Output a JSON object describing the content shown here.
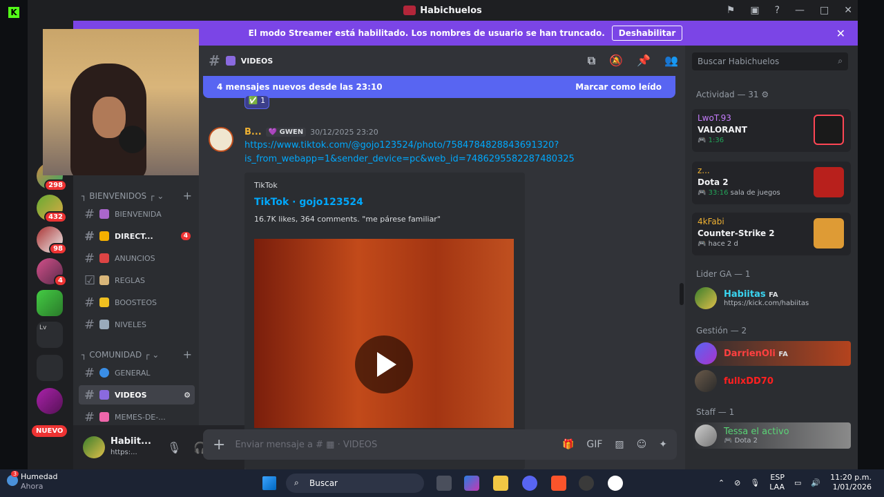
{
  "window": {
    "title": "Habichuelos"
  },
  "banner": {
    "text": "El modo Streamer está habilitado. Los nombres de usuario se han truncado.",
    "button": "Deshabilitar"
  },
  "channel_header": {
    "name": "VIDEOS"
  },
  "new_messages": {
    "text": "4 mensajes nuevos desde las 23:10",
    "mark_read": "Marcar como leído"
  },
  "servers": [
    {
      "badge": "298"
    },
    {
      "badge": "432"
    },
    {
      "badge": "98"
    },
    {
      "badge": "4"
    },
    {
      "badge": ""
    },
    {
      "badge": "Lv"
    }
  ],
  "server_nuevo": "NUEVO",
  "categories": {
    "bienvenidos": "BIENVENIDOS",
    "comunidad": "COMUNIDAD"
  },
  "channels": [
    {
      "name": "BIENVENIDA"
    },
    {
      "name": "DIRECT...",
      "badge": "4"
    },
    {
      "name": "ANUNCIOS"
    },
    {
      "name": "REGLAS"
    },
    {
      "name": "BOOSTEOS"
    },
    {
      "name": "NIVELES"
    },
    {
      "name": "GENERAL"
    },
    {
      "name": "VIDEOS"
    },
    {
      "name": "MEMES-DE-..."
    }
  ],
  "user": {
    "name": "Habiit...",
    "status": "https:..."
  },
  "message": {
    "reaction_count": "1",
    "author": "B...",
    "tag": "GWEN",
    "timestamp": "30/12/2025 23:20",
    "link_line1": "https://www.tiktok.com/@gojo123524/photo/7584784828843691320?",
    "link_line2": "is_from_webapp=1&sender_device=pc&web_id=7486295582287480325",
    "embed": {
      "provider": "TikTok",
      "title": "TikTok · gojo123524",
      "description": "16.7K likes, 364 comments. \"me párese familiar\""
    }
  },
  "composer": {
    "placeholder": "Enviar mensaje a #",
    "channel": "VIDEOS"
  },
  "members": {
    "search_placeholder": "Buscar Habichuelos",
    "activity_header": "Actividad — 31",
    "activities": [
      {
        "name": "LwoT.93",
        "game": "VALORANT",
        "duration": "1:36",
        "extra": "",
        "color": "#ff4655"
      },
      {
        "name": "z...",
        "game": "Dota 2",
        "duration": "33:16",
        "extra": "sala de juegos",
        "color": "#b8201c"
      },
      {
        "name": "4kFabi",
        "game": "Counter-Strike 2",
        "duration": "hace 2 d",
        "extra": "",
        "color": "#de9b35"
      }
    ],
    "lider_header": "Lider GA — 1",
    "lider": {
      "name": "Habiitas",
      "tag": "FA",
      "status": "https://kick.com/habiitas"
    },
    "gestion_header": "Gestión — 2",
    "gestion": [
      {
        "name": "DarrienOli",
        "tag": "FA"
      },
      {
        "name": "fullxDD70"
      }
    ],
    "staff_header": "Staff — 1",
    "staff": {
      "name": "Tessa el activo",
      "status": "Dota 2"
    }
  },
  "taskbar": {
    "weather_title": "Humedad",
    "weather_sub": "Ahora",
    "weather_badge": "3",
    "search": "Buscar",
    "lang": "ESP",
    "lang2": "LAA",
    "time": "11:20 p.m.",
    "date": "1/01/2026"
  }
}
